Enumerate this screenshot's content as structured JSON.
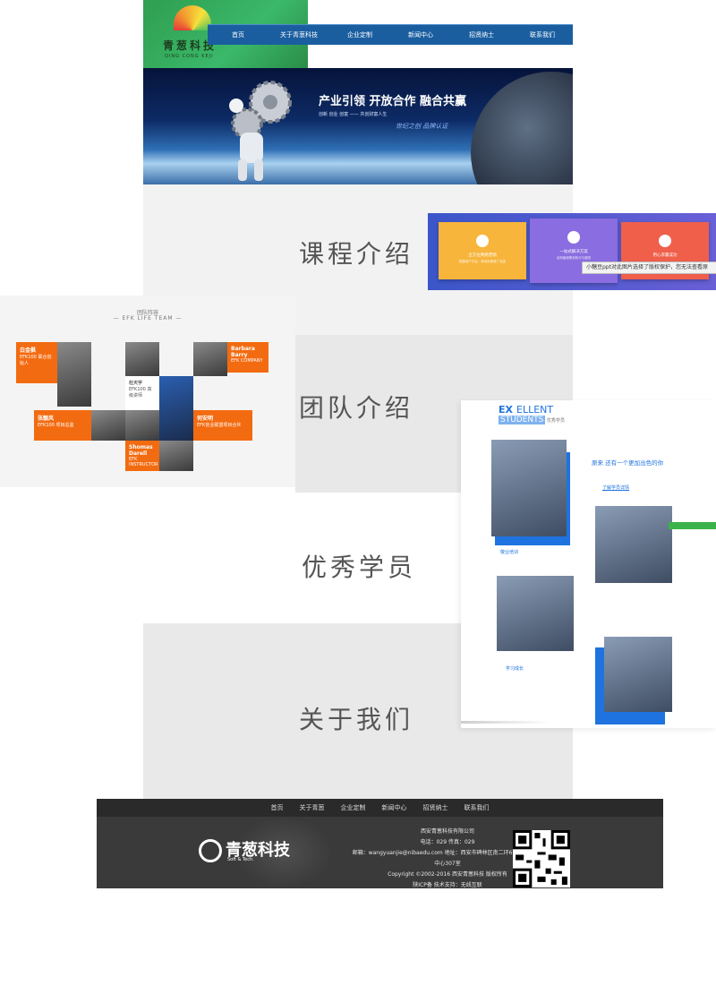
{
  "header": {
    "logo_text": "青葱科技",
    "logo_pinyin": "QING CONG KEJI",
    "nav": [
      "首页",
      "关于青葱科技",
      "企业定制",
      "新闻中心",
      "招贤纳士",
      "联系我们"
    ]
  },
  "banner": {
    "slogan_main": "产业引领  开放合作  融合共赢",
    "slogan_sub": "创新 创业 创富 —— 共创财富人生",
    "slogan_tag": "世纪之创 品牌认证"
  },
  "sections": {
    "courses": "课程介绍",
    "team": "团队介绍",
    "students": "优秀学员",
    "about": "关于我们"
  },
  "services": {
    "cards": [
      {
        "title": "全方位网络营销",
        "sub": "搭建用户平台，带动商家推广信息",
        "color": "#f7b53c",
        "icon": "diamond-icon"
      },
      {
        "title": "一站式解决方案",
        "sub": "全网营销策划执行与服务",
        "color": "#8a6de0",
        "icon": "shield-icon"
      },
      {
        "title": "用心求赢成功",
        "sub": "",
        "color": "#ef5f4a",
        "icon": "rocket-icon"
      }
    ],
    "tooltip": "小糖豆ppt对此图片选择了版权保护，您无法查看原"
  },
  "team": {
    "kicker": "团队阵容",
    "heading": "— EFK LIFE TEAM —",
    "members": [
      {
        "name": "白金枫",
        "desc": "EFK100 联合创始人"
      },
      {
        "name": "Barbara Barry",
        "desc": "EFK COMPANY"
      },
      {
        "name": "杜天宇",
        "desc": "EFK100 高级讲师"
      },
      {
        "name": "张靓风",
        "desc": "EFK100 项目总监"
      },
      {
        "name": "何安明",
        "desc": "EFK创业联盟项目合伙"
      },
      {
        "name": "Shomas Darell",
        "desc": "EFK INSTRUCTOR"
      }
    ]
  },
  "students": {
    "brand_top": "EX",
    "brand_mid": "ELLENT",
    "brand_bottom": "STUDENTS",
    "brand_cn": "优秀学员",
    "headline": "原来 还有一个更加出色的你",
    "links": [
      "了解学员详情",
      "敬业培训",
      "学习成长"
    ]
  },
  "footer": {
    "nav": [
      "首页",
      "关于青葱",
      "企业定制",
      "新闻中心",
      "招贤纳士",
      "联系我们"
    ],
    "logo": "青葱科技",
    "logo_sub": "Soft & Tech.",
    "company": "西安青葱科技有限公司",
    "phone": "电话：029 传真：029",
    "address": "邮箱：wangyuanjie@nibaedu.com 地址：西安市碑林区南二环69号创新设计",
    "address2": "中心307室",
    "copyright": "Copyright ©2002-2016 西安青葱科技 版权所有",
    "icp": "陕ICP备 技术支持：无线互联"
  }
}
